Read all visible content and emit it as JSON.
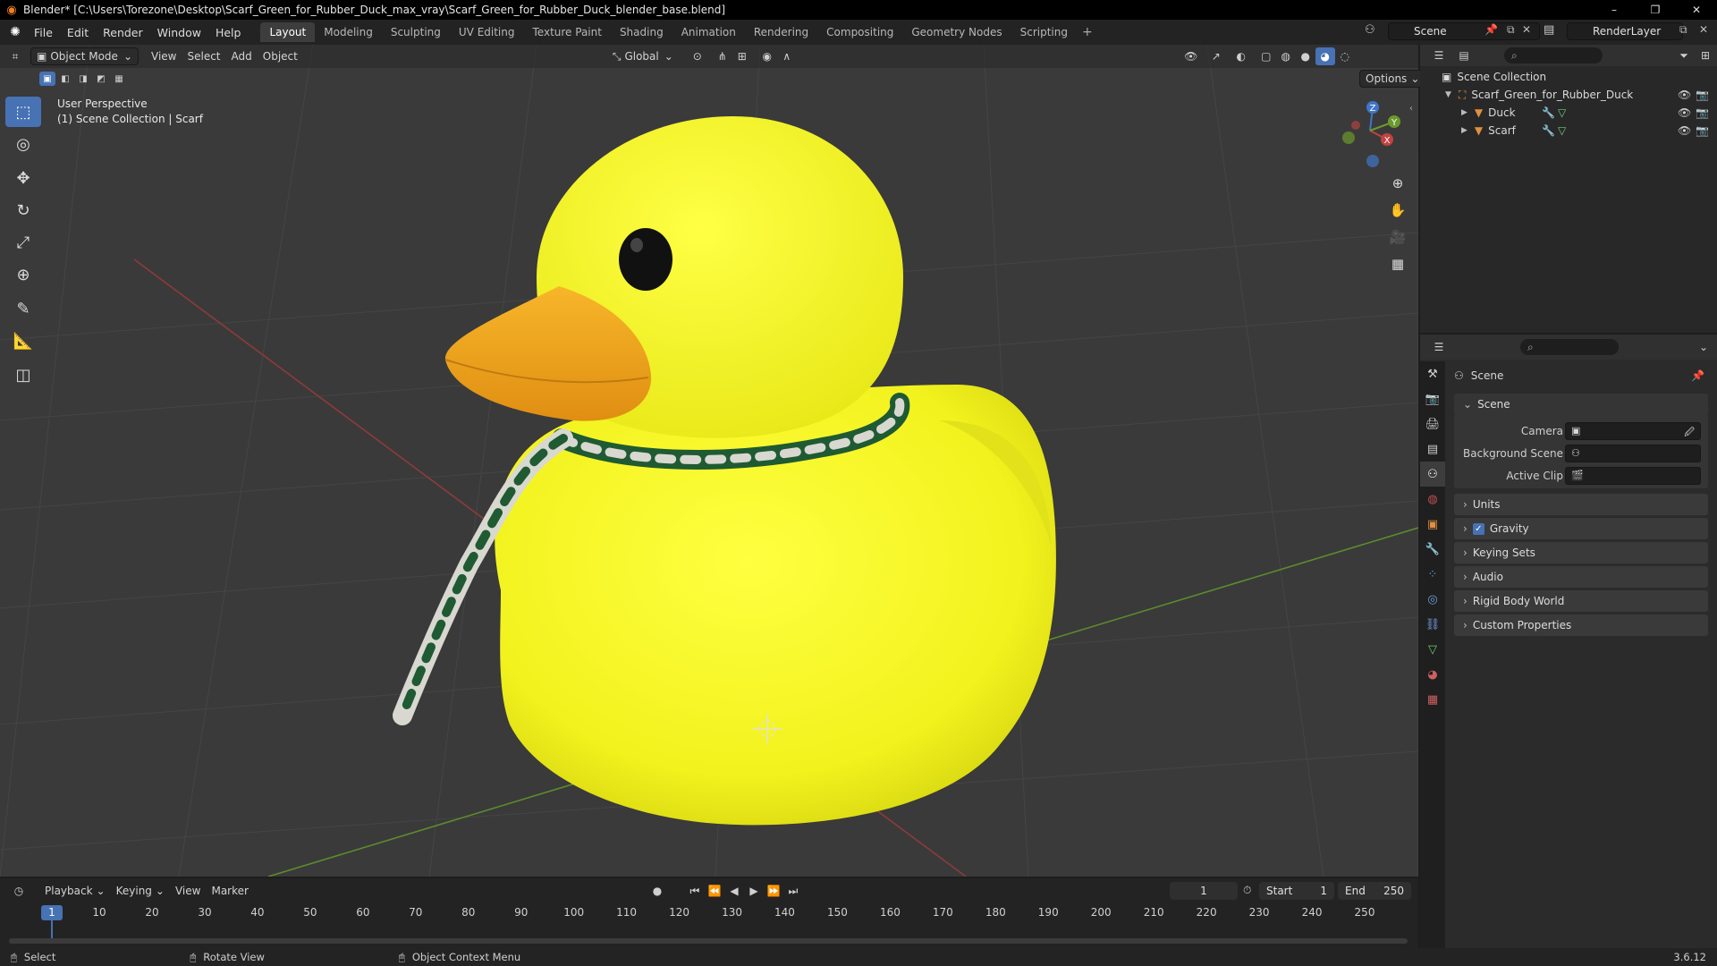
{
  "window": {
    "title": "Blender* [C:\\Users\\Torezone\\Desktop\\Scarf_Green_for_Rubber_Duck_max_vray\\Scarf_Green_for_Rubber_Duck_blender_base.blend]",
    "minimize": "–",
    "maximize": "❐",
    "close": "✕"
  },
  "menu": [
    "File",
    "Edit",
    "Render",
    "Window",
    "Help"
  ],
  "workspaces": [
    "Layout",
    "Modeling",
    "Sculpting",
    "UV Editing",
    "Texture Paint",
    "Shading",
    "Animation",
    "Rendering",
    "Compositing",
    "Geometry Nodes",
    "Scripting"
  ],
  "active_workspace": "Layout",
  "scene_name": "Scene",
  "view_layer": "RenderLayer",
  "viewport": {
    "mode": "Object Mode",
    "menus": [
      "View",
      "Select",
      "Add",
      "Object"
    ],
    "transform_orientation": "Global",
    "options_label": "Options",
    "info_line1": "User Perspective",
    "info_line2": "(1) Scene Collection | Scarf",
    "gizmo_axes": {
      "x": "X",
      "y": "Y",
      "z": "Z"
    }
  },
  "outliner": {
    "root": "Scene Collection",
    "collection": "Scarf_Green_for_Rubber_Duck",
    "objects": [
      "Duck",
      "Scarf"
    ]
  },
  "properties": {
    "header": "Scene",
    "section": "Scene",
    "fields": [
      {
        "label": "Camera"
      },
      {
        "label": "Background Scene"
      },
      {
        "label": "Active Clip"
      }
    ],
    "panels": [
      "Units",
      "Gravity",
      "Keying Sets",
      "Audio",
      "Rigid Body World",
      "Custom Properties"
    ],
    "gravity_checked": true
  },
  "timeline": {
    "menus": [
      "Playback",
      "Keying",
      "View",
      "Marker"
    ],
    "current_frame": "1",
    "start_label": "Start",
    "start": "1",
    "end_label": "End",
    "end": "250",
    "ticks": [
      "1",
      "10",
      "20",
      "30",
      "40",
      "50",
      "60",
      "70",
      "80",
      "90",
      "100",
      "110",
      "120",
      "130",
      "140",
      "150",
      "160",
      "170",
      "180",
      "190",
      "200",
      "210",
      "220",
      "230",
      "240",
      "250"
    ]
  },
  "statusbar": {
    "select": "Select",
    "rotate": "Rotate View",
    "context": "Object Context Menu",
    "version": "3.6.12"
  },
  "colors": {
    "accent": "#4772b3",
    "duck_yellow": "#f5f52a",
    "beak_orange": "#f2a61f",
    "scarf_green": "#1f5a33",
    "scarf_white": "#d8d8d0"
  }
}
